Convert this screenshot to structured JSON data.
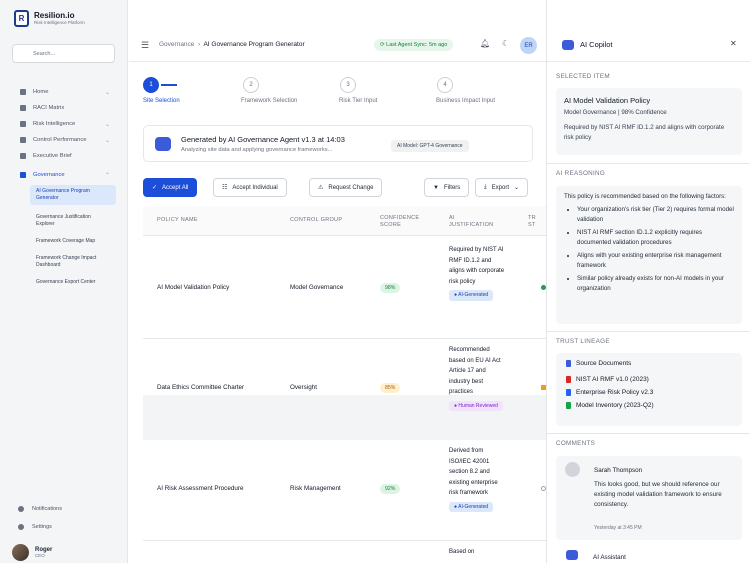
{
  "brand": {
    "name": "Resilion.io",
    "tagline": "Risk Intelligence Platform",
    "logo_glyph": "R"
  },
  "sidebar": {
    "search_placeholder": "Search...",
    "items": [
      {
        "label": "Home",
        "icon": "home-icon"
      },
      {
        "label": "RACI Matrix",
        "icon": "grid-icon"
      },
      {
        "label": "Risk Intelligence",
        "icon": "shield-icon"
      },
      {
        "label": "Control Performance",
        "icon": "gauge-icon"
      },
      {
        "label": "Executive Brief",
        "icon": "document-icon"
      },
      {
        "label": "Governance",
        "icon": "gavel-icon"
      }
    ],
    "governance_sub": [
      "AI Governance Program Generator",
      "Governance Justification Explorer",
      "Framework Coverage Map",
      "Framework Change Impact Dashboard",
      "Governance Export Center"
    ],
    "bottom": [
      "Notifications",
      "Settings"
    ],
    "user": {
      "name": "Roger",
      "role": "CEO"
    }
  },
  "topbar": {
    "breadcrumb_root": "Governance",
    "breadcrumb_current": "AI Governance Program Generator",
    "sync": "Last Agent Sync: 5m ago",
    "user_initials": "ER"
  },
  "steps": [
    {
      "num": "1",
      "label": "Site Selection"
    },
    {
      "num": "2",
      "label": "Framework Selection"
    },
    {
      "num": "3",
      "label": "Risk Tier Input"
    },
    {
      "num": "4",
      "label": "Business Impact Input"
    }
  ],
  "agent": {
    "title": "Generated by AI Governance Agent v1.3 at 14:03",
    "subtitle": "Analyzing site data and applying governance frameworks...",
    "model": "AI Model: GPT-4 Governance"
  },
  "toolbar": {
    "accept_all": "Accept All",
    "accept_individual": "Accept Individual",
    "request_change": "Request Change",
    "filters": "Filters",
    "export": "Export"
  },
  "table": {
    "headers": [
      "POLICY NAME",
      "CONTROL GROUP",
      "CONFIDENCE SCORE",
      "AI JUSTIFICATION",
      "TR ST"
    ],
    "rows": [
      {
        "policy": "AI Model Validation Policy",
        "group": "Model Governance",
        "confidence": "98%",
        "justification": "Required by NIST AI RMF ID.1.2 and aligns with corporate risk policy",
        "tag": "AI-Generated"
      },
      {
        "policy": "Data Ethics Committee Charter",
        "group": "Oversight",
        "confidence": "85%",
        "justification": "Recommended based on EU AI Act Article 17 and industry best practices",
        "tag": "Human Reviewed"
      },
      {
        "policy": "AI Risk Assessment Procedure",
        "group": "Risk Management",
        "confidence": "92%",
        "justification": "Derived from ISO/IEC 42001 section 8.2 and existing enterprise risk framework",
        "tag": "AI-Generated"
      },
      {
        "policy": "",
        "group": "",
        "confidence": "",
        "justification": "Based on",
        "tag": ""
      }
    ]
  },
  "copilot": {
    "title": "AI Copilot",
    "selected_label": "SELECTED ITEM",
    "selected_title": "AI Model Validation Policy",
    "selected_meta": "Model Governance | 98% Confidence",
    "selected_desc": "Required by NIST AI RMF ID.1.2 and aligns with corporate risk policy",
    "reasoning_label": "AI REASONING",
    "reasoning_intro": "This policy is recommended based on the following factors:",
    "reasoning": [
      "Your organization's risk tier (Tier 2) requires formal model validation",
      "NIST AI RMF section ID.1.2 explicitly requires documented validation procedures",
      "Aligns with your existing enterprise risk management framework",
      "Similar policy already exists for non-AI models in your organization"
    ],
    "lineage_label": "TRUST LINEAGE",
    "lineage_head": "Source Documents",
    "lineage": [
      "NIST AI RMF v1.0 (2023)",
      "Enterprise Risk Policy v2.3",
      "Model Inventory (2023-Q2)"
    ],
    "comments_label": "COMMENTS",
    "comment_author": "Sarah Thompson",
    "comment_text": "This looks good, but we should reference our existing model validation framework to ensure consistency.",
    "comment_time": "Yesterday at 3:45 PM",
    "assistant_label": "AI Assistant"
  },
  "colors": {
    "accent": "#1d4ed8",
    "success": "#15803d",
    "warning": "#b45309"
  }
}
